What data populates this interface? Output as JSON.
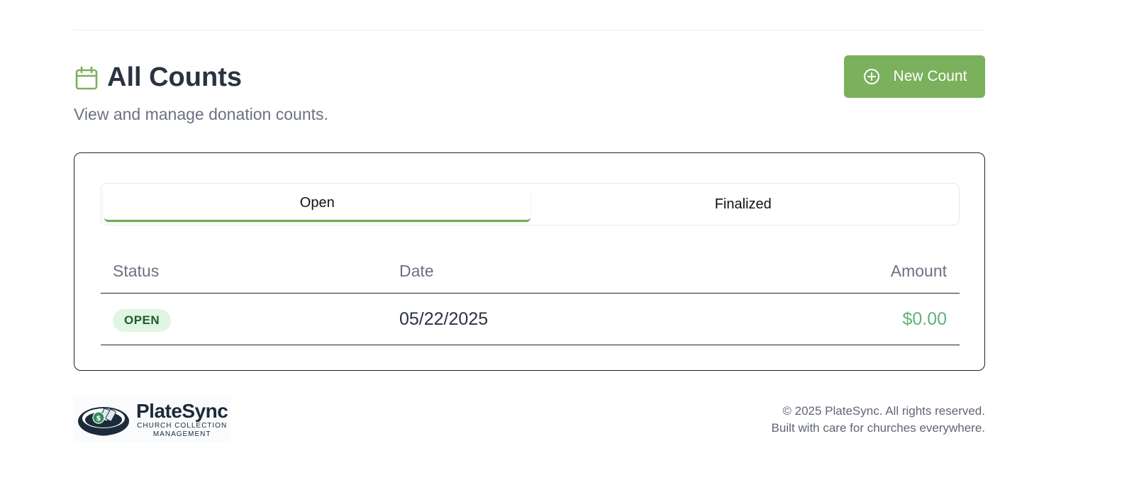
{
  "header": {
    "title": "All Counts",
    "subtitle": "View and manage donation counts.",
    "new_button_label": "New Count"
  },
  "tabs": [
    {
      "label": "Open",
      "active": true
    },
    {
      "label": "Finalized",
      "active": false
    }
  ],
  "table": {
    "columns": [
      "Status",
      "Date",
      "Amount"
    ],
    "rows": [
      {
        "status": "OPEN",
        "date": "05/22/2025",
        "amount": "$0.00"
      }
    ]
  },
  "footer": {
    "logo_name": "PlateSync",
    "logo_tagline_1": "CHURCH COLLECTION",
    "logo_tagline_2": "MANAGEMENT",
    "copyright": "© 2025 PlateSync. All rights reserved.",
    "tagline": "Built with care for churches everywhere."
  },
  "colors": {
    "accent": "#7bb05c",
    "status_open_bg": "#dff6e3",
    "status_open_text": "#1e5a32",
    "amount": "#62b27a"
  },
  "icons": {
    "title_icon": "calendar-icon",
    "button_icon": "plus-circle-icon"
  }
}
